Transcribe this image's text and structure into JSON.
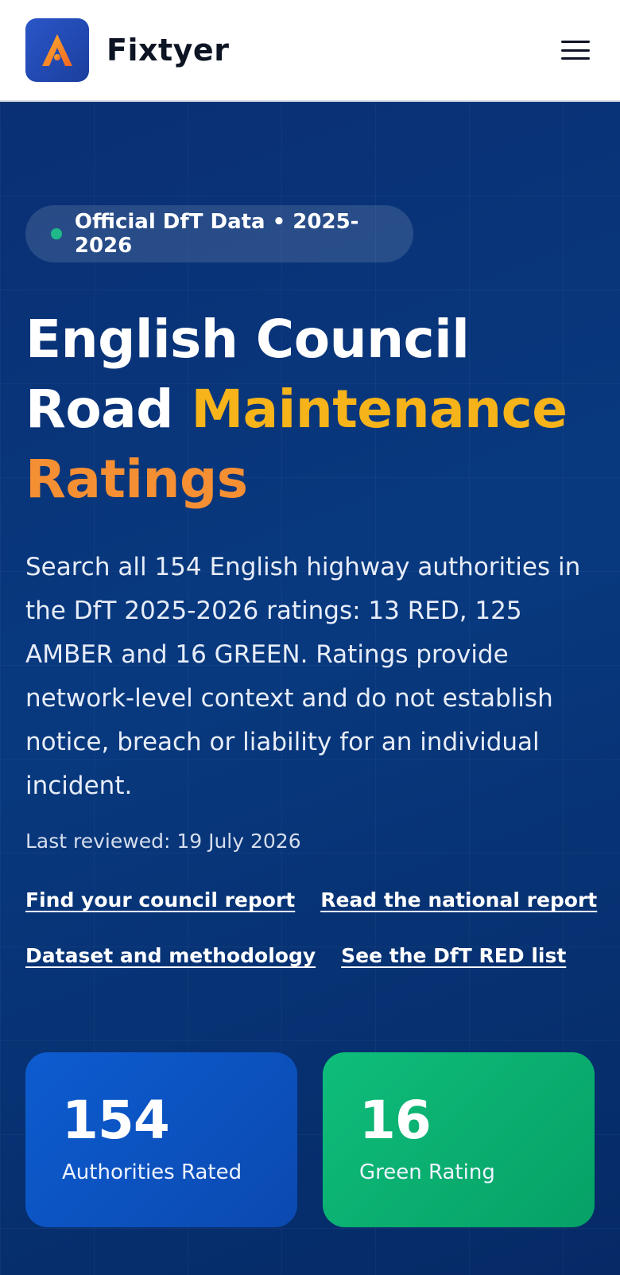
{
  "header": {
    "brand_name": "Fixtyer",
    "logo_icon": "fixtyer-logo-icon",
    "menu_icon": "hamburger-menu-icon"
  },
  "hero": {
    "badge": "Official DfT Data • 2025-2026",
    "title_part1": "English Council Road ",
    "title_part2": "Mainte",
    "title_part3": "nance",
    "title_part4": "Ratings",
    "description": "Search all 154 English highway authorities in the DfT 2025-2026 ratings: 13 RED, 125 AMBER and 16 GREEN. Ratings provide network-level context and do not establish notice, breach or liability for an individual incident.",
    "last_reviewed": "Last reviewed: 19 July 2026",
    "links": [
      "Find your council report",
      "Read the national report",
      "Dataset and methodology",
      "See the DfT RED list"
    ]
  },
  "stats": [
    {
      "value": "154",
      "label": "Authorities Rated"
    },
    {
      "value": "16",
      "label": "Green Rating"
    }
  ],
  "colors": {
    "accent_yellow": "#f6b31a",
    "accent_orange": "#f58f33",
    "hero_bg": "#0a2f73",
    "stat_blue": "#0d5cd0",
    "stat_green": "#0fbd7a"
  }
}
